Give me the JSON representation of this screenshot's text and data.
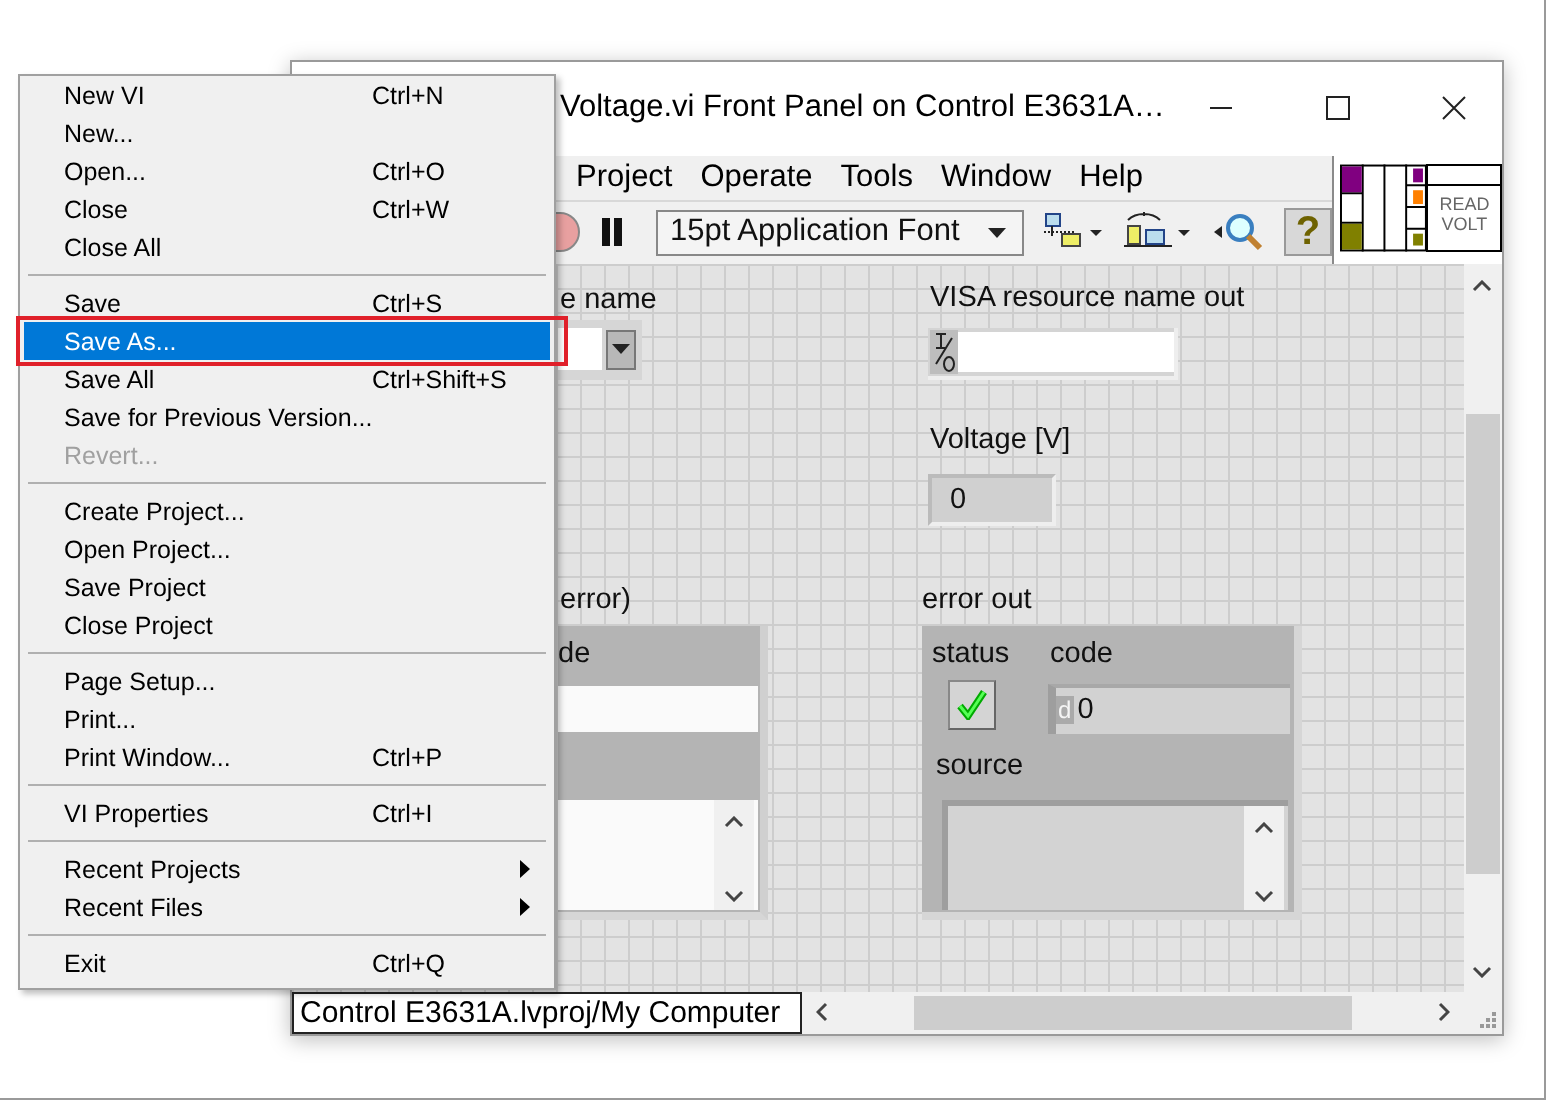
{
  "menu": {
    "groups": [
      [
        {
          "label": "New VI",
          "shortcut": "Ctrl+N",
          "kind": "item",
          "disabled": false,
          "selected": false,
          "outlined": false
        },
        {
          "label": "New...",
          "kind": "item",
          "disabled": false,
          "selected": false,
          "outlined": false
        },
        {
          "label": "Open...",
          "shortcut": "Ctrl+O",
          "kind": "item",
          "disabled": false,
          "selected": false,
          "outlined": false
        },
        {
          "label": "Close",
          "shortcut": "Ctrl+W",
          "kind": "item",
          "disabled": false,
          "selected": false,
          "outlined": false
        },
        {
          "label": "Close All",
          "kind": "item",
          "disabled": false,
          "selected": false,
          "outlined": false
        }
      ],
      [
        {
          "label": "Save",
          "shortcut": "Ctrl+S",
          "kind": "item",
          "disabled": false,
          "selected": false,
          "outlined": false
        },
        {
          "label": "Save As...",
          "kind": "item",
          "disabled": false,
          "selected": true,
          "outlined": true
        },
        {
          "label": "Save All",
          "shortcut": "Ctrl+Shift+S",
          "kind": "item",
          "disabled": false,
          "selected": false,
          "outlined": false
        },
        {
          "label": "Save for Previous Version...",
          "kind": "item",
          "disabled": false,
          "selected": false,
          "outlined": false
        },
        {
          "label": "Revert...",
          "kind": "item",
          "disabled": true,
          "selected": false,
          "outlined": false
        }
      ],
      [
        {
          "label": "Create Project...",
          "kind": "item",
          "disabled": false,
          "selected": false,
          "outlined": false
        },
        {
          "label": "Open Project...",
          "kind": "item",
          "disabled": false,
          "selected": false,
          "outlined": false
        },
        {
          "label": "Save Project",
          "kind": "item",
          "disabled": false,
          "selected": false,
          "outlined": false
        },
        {
          "label": "Close Project",
          "kind": "item",
          "disabled": false,
          "selected": false,
          "outlined": false
        }
      ],
      [
        {
          "label": "Page Setup...",
          "kind": "item",
          "disabled": false,
          "selected": false,
          "outlined": false
        },
        {
          "label": "Print...",
          "kind": "item",
          "disabled": false,
          "selected": false,
          "outlined": false
        },
        {
          "label": "Print Window...",
          "shortcut": "Ctrl+P",
          "kind": "item",
          "disabled": false,
          "selected": false,
          "outlined": false
        }
      ],
      [
        {
          "label": "VI Properties",
          "shortcut": "Ctrl+I",
          "kind": "item",
          "disabled": false,
          "selected": false,
          "outlined": false
        }
      ],
      [
        {
          "label": "Recent Projects",
          "kind": "submenu",
          "disabled": false,
          "selected": false,
          "outlined": false
        },
        {
          "label": "Recent Files",
          "kind": "submenu",
          "disabled": false,
          "selected": false,
          "outlined": false
        }
      ],
      [
        {
          "label": "Exit",
          "shortcut": "Ctrl+Q",
          "kind": "item",
          "disabled": false,
          "selected": false,
          "outlined": false
        }
      ]
    ]
  },
  "window": {
    "title": "Voltage.vi Front Panel on Control E3631A…",
    "menus": [
      "Project",
      "Operate",
      "Tools",
      "Window",
      "Help"
    ],
    "toolbar": {
      "font": "15pt Application Font",
      "help": "?"
    },
    "vi_icon": [
      "READ",
      "VOLT"
    ],
    "panel": {
      "controls": [
        {
          "kind": "ring",
          "label": "e name"
        },
        {
          "kind": "visa_indicator",
          "label": "VISA resource name out"
        },
        {
          "kind": "numeric_indicator",
          "label": "Voltage [V]",
          "value": "0"
        },
        {
          "kind": "error_cluster",
          "label": "error)",
          "code_label": "de",
          "indicator": false
        },
        {
          "kind": "error_cluster",
          "label": "error out",
          "status_label": "status",
          "status": true,
          "code_label": "code",
          "radix": "d",
          "code": "0",
          "source_label": "source",
          "indicator": true
        }
      ]
    },
    "status_path": "Control E3631A.lvproj/My Computer"
  }
}
